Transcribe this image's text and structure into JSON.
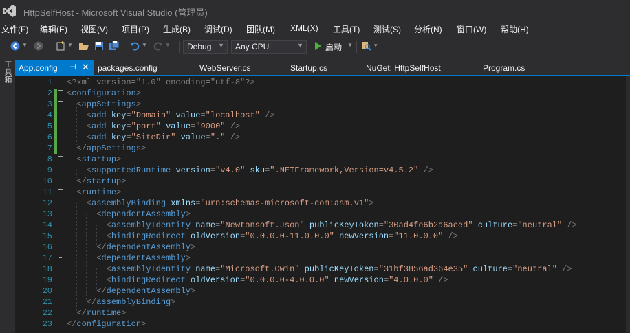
{
  "window": {
    "title": "HttpSelfHost - Microsoft Visual Studio (管理员)"
  },
  "menu": [
    "文件(F)",
    "编辑(E)",
    "视图(V)",
    "项目(P)",
    "生成(B)",
    "调试(D)",
    "团队(M)",
    "XML(X)",
    "工具(T)",
    "测试(S)",
    "分析(N)",
    "窗口(W)",
    "帮助(H)"
  ],
  "toolbar": {
    "config_value": "Debug",
    "platform_value": "Any CPU",
    "start_label": "启动"
  },
  "side": {
    "toolbox_label": "工具箱"
  },
  "tabs": [
    {
      "label": "App.config",
      "active": true
    },
    {
      "label": "packages.config"
    },
    {
      "label": "WebServer.cs"
    },
    {
      "label": "Startup.cs"
    },
    {
      "label": "NuGet: HttpSelfHost"
    },
    {
      "label": "Program.cs"
    }
  ],
  "editor": {
    "line_numbers": [
      "1",
      "2",
      "3",
      "4",
      "5",
      "6",
      "7",
      "8",
      "9",
      "10",
      "11",
      "12",
      "13",
      "14",
      "15",
      "16",
      "17",
      "18",
      "19",
      "20",
      "21",
      "22",
      "23"
    ],
    "lines": [
      [
        [
          "pi",
          "<?xml version=\"1.0\" encoding=\"utf-8\"?>"
        ]
      ],
      [
        [
          "pun",
          "<"
        ],
        [
          "tag",
          "configuration"
        ],
        [
          "pun",
          ">"
        ]
      ],
      [
        [
          "pun",
          "  <"
        ],
        [
          "tag",
          "appSettings"
        ],
        [
          "pun",
          ">"
        ]
      ],
      [
        [
          "pun",
          "    <"
        ],
        [
          "tag",
          "add"
        ],
        [
          "val",
          " "
        ],
        [
          "attr",
          "key"
        ],
        [
          "pun",
          "="
        ],
        [
          "str",
          "\"Domain\""
        ],
        [
          "val",
          " "
        ],
        [
          "attr",
          "value"
        ],
        [
          "pun",
          "="
        ],
        [
          "str",
          "\"localhost\""
        ],
        [
          "pun",
          " />"
        ]
      ],
      [
        [
          "pun",
          "    <"
        ],
        [
          "tag",
          "add"
        ],
        [
          "val",
          " "
        ],
        [
          "attr",
          "key"
        ],
        [
          "pun",
          "="
        ],
        [
          "str",
          "\"port\""
        ],
        [
          "val",
          " "
        ],
        [
          "attr",
          "value"
        ],
        [
          "pun",
          "="
        ],
        [
          "str",
          "\"9000\""
        ],
        [
          "pun",
          " />"
        ]
      ],
      [
        [
          "pun",
          "    <"
        ],
        [
          "tag",
          "add"
        ],
        [
          "val",
          " "
        ],
        [
          "attr",
          "key"
        ],
        [
          "pun",
          "="
        ],
        [
          "str",
          "\"SiteDir\""
        ],
        [
          "val",
          " "
        ],
        [
          "attr",
          "value"
        ],
        [
          "pun",
          "="
        ],
        [
          "str",
          "\".\""
        ],
        [
          "pun",
          " />"
        ]
      ],
      [
        [
          "pun",
          "  </"
        ],
        [
          "tag",
          "appSettings"
        ],
        [
          "pun",
          ">"
        ]
      ],
      [
        [
          "pun",
          "  <"
        ],
        [
          "tag",
          "startup"
        ],
        [
          "pun",
          ">"
        ]
      ],
      [
        [
          "pun",
          "    <"
        ],
        [
          "tag",
          "supportedRuntime"
        ],
        [
          "val",
          " "
        ],
        [
          "attr",
          "version"
        ],
        [
          "pun",
          "="
        ],
        [
          "str",
          "\"v4.0\""
        ],
        [
          "val",
          " "
        ],
        [
          "attr",
          "sku"
        ],
        [
          "pun",
          "="
        ],
        [
          "str",
          "\".NETFramework,Version=v4.5.2\""
        ],
        [
          "pun",
          " />"
        ]
      ],
      [
        [
          "pun",
          "  </"
        ],
        [
          "tag",
          "startup"
        ],
        [
          "pun",
          ">"
        ]
      ],
      [
        [
          "pun",
          "  <"
        ],
        [
          "tag",
          "runtime"
        ],
        [
          "pun",
          ">"
        ]
      ],
      [
        [
          "pun",
          "    <"
        ],
        [
          "tag",
          "assemblyBinding"
        ],
        [
          "val",
          " "
        ],
        [
          "attr",
          "xmlns"
        ],
        [
          "pun",
          "="
        ],
        [
          "str",
          "\"urn:schemas-microsoft-com:asm.v1\""
        ],
        [
          "pun",
          ">"
        ]
      ],
      [
        [
          "pun",
          "      <"
        ],
        [
          "tag",
          "dependentAssembly"
        ],
        [
          "pun",
          ">"
        ]
      ],
      [
        [
          "pun",
          "        <"
        ],
        [
          "tag",
          "assemblyIdentity"
        ],
        [
          "val",
          " "
        ],
        [
          "attr",
          "name"
        ],
        [
          "pun",
          "="
        ],
        [
          "str",
          "\"Newtonsoft.Json\""
        ],
        [
          "val",
          " "
        ],
        [
          "attr",
          "publicKeyToken"
        ],
        [
          "pun",
          "="
        ],
        [
          "str",
          "\"30ad4fe6b2a6aeed\""
        ],
        [
          "val",
          " "
        ],
        [
          "attr",
          "culture"
        ],
        [
          "pun",
          "="
        ],
        [
          "str",
          "\"neutral\""
        ],
        [
          "pun",
          " />"
        ]
      ],
      [
        [
          "pun",
          "        <"
        ],
        [
          "tag",
          "bindingRedirect"
        ],
        [
          "val",
          " "
        ],
        [
          "attr",
          "oldVersion"
        ],
        [
          "pun",
          "="
        ],
        [
          "str",
          "\"0.0.0.0-11.0.0.0\""
        ],
        [
          "val",
          " "
        ],
        [
          "attr",
          "newVersion"
        ],
        [
          "pun",
          "="
        ],
        [
          "str",
          "\"11.0.0.0\""
        ],
        [
          "pun",
          " />"
        ]
      ],
      [
        [
          "pun",
          "      </"
        ],
        [
          "tag",
          "dependentAssembly"
        ],
        [
          "pun",
          ">"
        ]
      ],
      [
        [
          "pun",
          "      <"
        ],
        [
          "tag",
          "dependentAssembly"
        ],
        [
          "pun",
          ">"
        ]
      ],
      [
        [
          "pun",
          "        <"
        ],
        [
          "tag",
          "assemblyIdentity"
        ],
        [
          "val",
          " "
        ],
        [
          "attr",
          "name"
        ],
        [
          "pun",
          "="
        ],
        [
          "str",
          "\"Microsoft.Owin\""
        ],
        [
          "val",
          " "
        ],
        [
          "attr",
          "publicKeyToken"
        ],
        [
          "pun",
          "="
        ],
        [
          "str",
          "\"31bf3856ad364e35\""
        ],
        [
          "val",
          " "
        ],
        [
          "attr",
          "culture"
        ],
        [
          "pun",
          "="
        ],
        [
          "str",
          "\"neutral\""
        ],
        [
          "pun",
          " />"
        ]
      ],
      [
        [
          "pun",
          "        <"
        ],
        [
          "tag",
          "bindingRedirect"
        ],
        [
          "val",
          " "
        ],
        [
          "attr",
          "oldVersion"
        ],
        [
          "pun",
          "="
        ],
        [
          "str",
          "\"0.0.0.0-4.0.0.0\""
        ],
        [
          "val",
          " "
        ],
        [
          "attr",
          "newVersion"
        ],
        [
          "pun",
          "="
        ],
        [
          "str",
          "\"4.0.0.0\""
        ],
        [
          "pun",
          " />"
        ]
      ],
      [
        [
          "pun",
          "      </"
        ],
        [
          "tag",
          "dependentAssembly"
        ],
        [
          "pun",
          ">"
        ]
      ],
      [
        [
          "pun",
          "    </"
        ],
        [
          "tag",
          "assemblyBinding"
        ],
        [
          "pun",
          ">"
        ]
      ],
      [
        [
          "pun",
          "  </"
        ],
        [
          "tag",
          "runtime"
        ],
        [
          "pun",
          ">"
        ]
      ],
      [
        [
          "pun",
          "</"
        ],
        [
          "tag",
          "configuration"
        ],
        [
          "pun",
          ">"
        ]
      ]
    ]
  },
  "colors": {
    "accent": "#007acc",
    "editor_bg": "#1e1e1e",
    "line_number": "#2b91af",
    "xml_tag": "#569cd6",
    "xml_attr": "#9cdcfe",
    "xml_string": "#d69d85",
    "change_marker": "#57a64a"
  }
}
